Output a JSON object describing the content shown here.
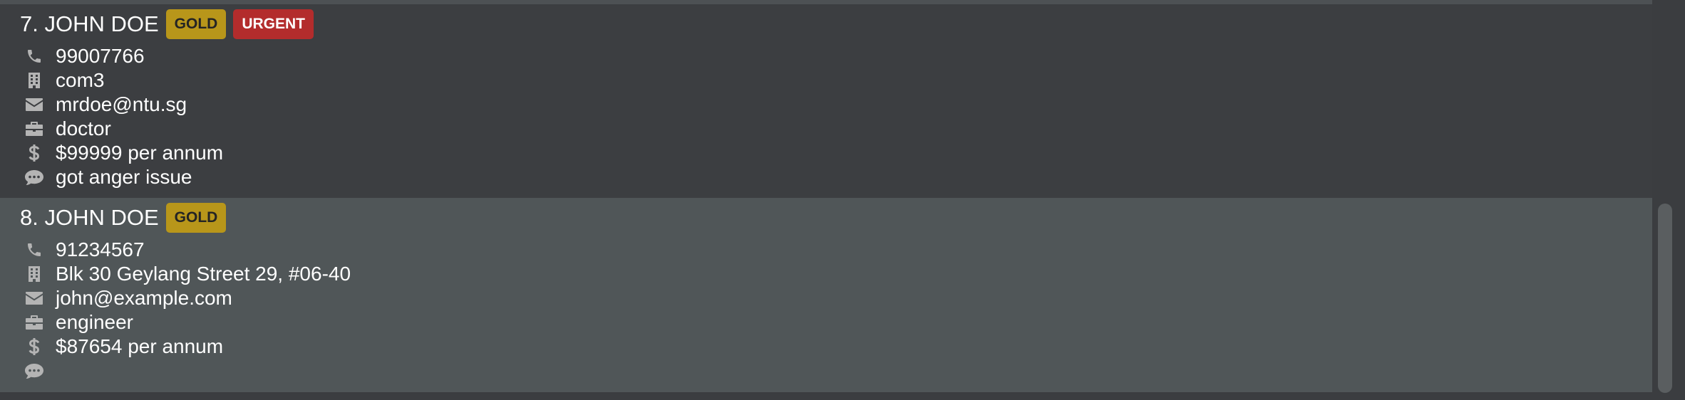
{
  "persons": [
    {
      "name": "7. JOHN DOE",
      "tags": [
        {
          "label": "GOLD",
          "kind": "gold"
        },
        {
          "label": "URGENT",
          "kind": "urgent"
        }
      ],
      "phone": "99007766",
      "address": "com3",
      "email": "mrdoe@ntu.sg",
      "job": "doctor",
      "salary": "$99999 per annum",
      "remark": "got anger issue"
    },
    {
      "name": "8. JOHN DOE",
      "tags": [
        {
          "label": "GOLD",
          "kind": "gold"
        }
      ],
      "phone": "91234567",
      "address": "Blk 30 Geylang Street 29, #06-40",
      "email": "john@example.com",
      "job": "engineer",
      "salary": "$87654 per annum",
      "remark": ""
    }
  ],
  "icons": {
    "phone": "phone-icon",
    "address": "building-icon",
    "email": "envelope-icon",
    "job": "briefcase-icon",
    "salary": "dollar-icon",
    "remark": "comment-icon"
  },
  "colors": {
    "selected_card_bg": "#505658",
    "card_bg": "#3c3e41",
    "gold_tag": "#b8961a",
    "urgent_tag": "#b32c2c",
    "icon": "#b4b4b4",
    "text": "#ffffff"
  }
}
